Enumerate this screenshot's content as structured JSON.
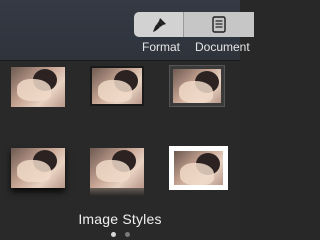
{
  "toolbar": {
    "segments": [
      {
        "label": "Format",
        "icon": "paintbrush-icon",
        "selected": true
      },
      {
        "label": "Document",
        "icon": "document-icon",
        "selected": false
      }
    ]
  },
  "panel": {
    "title": "Image Styles",
    "page_indicator": {
      "pages": 2,
      "current": 1
    }
  },
  "styles": [
    {
      "name": "plain",
      "selected": false
    },
    {
      "name": "thin-border",
      "selected": false
    },
    {
      "name": "bevel-frame",
      "selected": false
    },
    {
      "name": "drop-shadow",
      "selected": false
    },
    {
      "name": "reflection",
      "selected": false
    },
    {
      "name": "white-frame",
      "selected": false
    }
  ]
}
